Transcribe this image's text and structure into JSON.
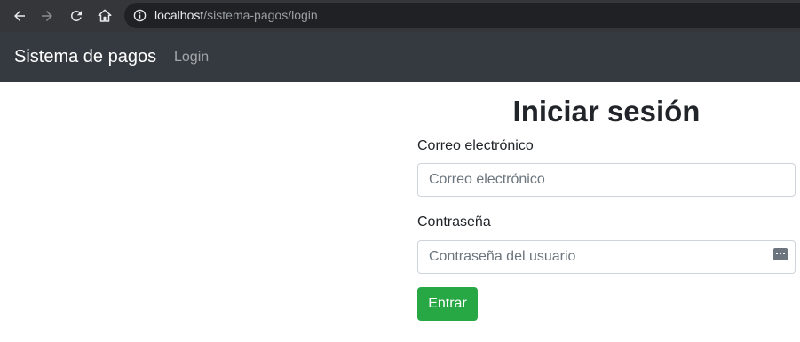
{
  "browser": {
    "url_host": "localhost",
    "url_path": "/sistema-pagos/login",
    "icons": [
      "back-icon",
      "forward-icon",
      "reload-icon",
      "home-icon",
      "info-icon"
    ]
  },
  "navbar": {
    "brand": "Sistema de pagos",
    "links": [
      {
        "label": "Login"
      }
    ]
  },
  "form": {
    "title": "Iniciar sesión",
    "email_label": "Correo electrónico",
    "email_placeholder": "Correo electrónico",
    "email_value": "",
    "password_label": "Contraseña",
    "password_placeholder": "Contraseña del usuario",
    "password_value": "",
    "submit_label": "Entrar"
  },
  "colors": {
    "navbar_bg": "#343a40",
    "submit_bg": "#28a745",
    "chrome_bg": "#35363a"
  }
}
